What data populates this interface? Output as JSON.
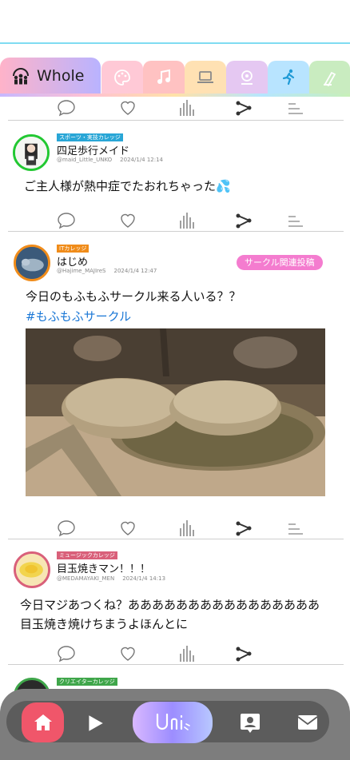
{
  "header": {
    "title": ""
  },
  "tabs": [
    {
      "label": "Whole",
      "icon": "community-icon"
    },
    {
      "icon": "palette-icon",
      "color": "#ffc2cf"
    },
    {
      "icon": "music-note-icon",
      "color": "#ffc2c2"
    },
    {
      "icon": "laptop-icon",
      "color": "#ffe1b3"
    },
    {
      "icon": "gear-hand-icon",
      "color": "#e5c8f2"
    },
    {
      "icon": "runner-icon",
      "color": "#b8e4ff"
    },
    {
      "icon": "study-icon",
      "color": "#c9ecc0"
    }
  ],
  "posts": [
    {
      "badge": "スポーツ・実技カレッジ",
      "badge_color": "#29a6d6",
      "name": "四足歩行メイド",
      "handle": "@maid_Little_UNKO",
      "time": "2024/1/4 12:14",
      "text": "ご主人様が熱中症でたおれちゃった💦"
    },
    {
      "badge": "ITカレッジ",
      "badge_color": "#f08c1a",
      "name": "はじめ",
      "handle": "@Hajime_MAJIreS",
      "time": "2024/1/4 12:47",
      "tag": "サークル関連投稿",
      "text": "今日のもふもふサークル来る人いる？？",
      "hashtag": "#もふもふサークル",
      "image": "tortoises-photo"
    },
    {
      "badge": "ミュージックカレッジ",
      "badge_color": "#d9607a",
      "name": "目玉焼きマン！！！",
      "handle": "@MEDAMAYAKI_MEN",
      "time": "2024/1/4 14:13",
      "text_line1": "今日マジあつくね？ああああああああああああああああ",
      "text_line2": "目玉焼き焼けちまうよほんとに"
    },
    {
      "badge": "クリエイターカレッジ",
      "badge_color": "#3fa64a"
    }
  ],
  "bottom_nav": {
    "items": [
      "home-icon",
      "play-icon",
      "uni-logo",
      "profile-icon",
      "mail-icon"
    ],
    "logo_text": "Uni"
  }
}
